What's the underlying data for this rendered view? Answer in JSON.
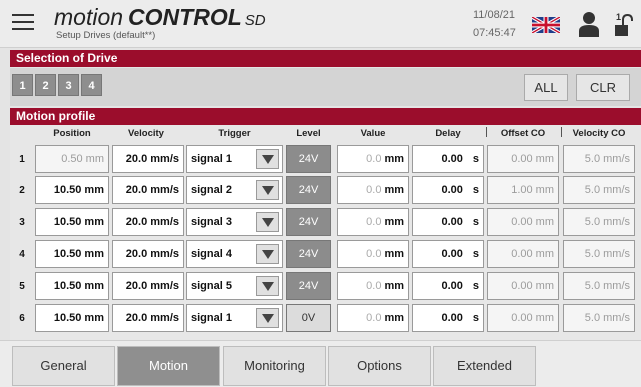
{
  "header": {
    "brand_motion": "motion",
    "brand_control": "CONTROL",
    "brand_sd": "SD",
    "subtitle": "Setup Drives (default**)",
    "date": "11/08/21",
    "time": "07:45:47",
    "icons": {
      "menu": "menu-icon",
      "flag": "uk-flag-icon",
      "user": "user-icon",
      "lock": "unlock-icon"
    }
  },
  "drive_selection": {
    "title": "Selection of Drive",
    "drives": [
      "1",
      "2",
      "3",
      "4"
    ],
    "all_label": "ALL",
    "clr_label": "CLR"
  },
  "motion_profile": {
    "title": "Motion profile",
    "columns": [
      "Position",
      "Velocity",
      "Trigger",
      "Level",
      "Value",
      "Delay",
      "Offset CO",
      "Velocity CO"
    ],
    "rows": [
      {
        "num": "1",
        "position": "0.50 mm",
        "velocity": "20.0 mm/s",
        "trigger": "signal 1",
        "level": "24V",
        "value": "0.0",
        "value_unit": "mm",
        "delay": "0.00",
        "delay_unit": "s",
        "offset": "0.00 mm",
        "velocity_co": "5.0 mm/s"
      },
      {
        "num": "2",
        "position": "10.50 mm",
        "velocity": "20.0 mm/s",
        "trigger": "signal 2",
        "level": "24V",
        "value": "0.0",
        "value_unit": "mm",
        "delay": "0.00",
        "delay_unit": "s",
        "offset": "1.00 mm",
        "velocity_co": "5.0 mm/s"
      },
      {
        "num": "3",
        "position": "10.50 mm",
        "velocity": "20.0 mm/s",
        "trigger": "signal 3",
        "level": "24V",
        "value": "0.0",
        "value_unit": "mm",
        "delay": "0.00",
        "delay_unit": "s",
        "offset": "0.00 mm",
        "velocity_co": "5.0 mm/s"
      },
      {
        "num": "4",
        "position": "10.50 mm",
        "velocity": "20.0 mm/s",
        "trigger": "signal 4",
        "level": "24V",
        "value": "0.0",
        "value_unit": "mm",
        "delay": "0.00",
        "delay_unit": "s",
        "offset": "0.00 mm",
        "velocity_co": "5.0 mm/s"
      },
      {
        "num": "5",
        "position": "10.50 mm",
        "velocity": "20.0 mm/s",
        "trigger": "signal 5",
        "level": "24V",
        "value": "0.0",
        "value_unit": "mm",
        "delay": "0.00",
        "delay_unit": "s",
        "offset": "0.00 mm",
        "velocity_co": "5.0 mm/s"
      },
      {
        "num": "6",
        "position": "10.50 mm",
        "velocity": "20.0 mm/s",
        "trigger": "signal 1",
        "level": "0V",
        "value": "0.0",
        "value_unit": "mm",
        "delay": "0.00",
        "delay_unit": "s",
        "offset": "0.00 mm",
        "velocity_co": "5.0 mm/s"
      }
    ],
    "dropdown_icon": "chevron-down-icon"
  },
  "tabs": [
    {
      "label": "General",
      "active": false
    },
    {
      "label": "Motion",
      "active": true
    },
    {
      "label": "Monitoring",
      "active": false
    },
    {
      "label": "Options",
      "active": false
    },
    {
      "label": "Extended",
      "active": false
    }
  ],
  "colors": {
    "accent": "#9b0d2c",
    "button_dark": "#8e8e8e",
    "background": "#e4e4e4"
  }
}
